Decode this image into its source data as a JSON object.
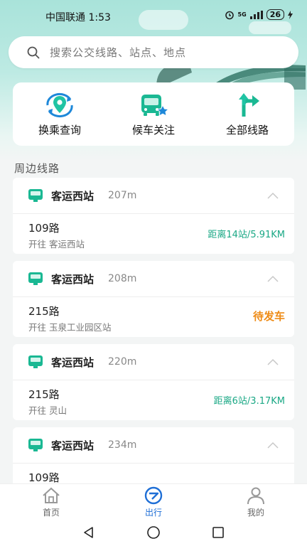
{
  "status_bar": {
    "carrier_time": "中国联通 1:53",
    "signal_label": "5G",
    "battery": "26"
  },
  "search": {
    "placeholder": "搜索公交线路、站点、地点",
    "icon": "search-icon"
  },
  "quick_actions": [
    {
      "label": "换乘查询",
      "icon": "transfer-location-icon"
    },
    {
      "label": "候车关注",
      "icon": "bus-star-icon"
    },
    {
      "label": "全部线路",
      "icon": "route-fork-icon"
    }
  ],
  "section_title": "周边线路",
  "stops": [
    {
      "name": "客运西站",
      "distance": "207m",
      "route": "109路",
      "dest": "开往 客运西站",
      "status": "距离14站/5.91KM",
      "status_type": "distance"
    },
    {
      "name": "客运西站",
      "distance": "208m",
      "route": "215路",
      "dest": "开往 玉泉工业园区站",
      "status": "待发车",
      "status_type": "waiting"
    },
    {
      "name": "客运西站",
      "distance": "220m",
      "route": "215路",
      "dest": "开往 灵山",
      "status": "距离6站/3.17KM",
      "status_type": "distance"
    },
    {
      "name": "客运西站",
      "distance": "234m",
      "route": "109路",
      "dest": "",
      "status": "",
      "status_type": "distance"
    }
  ],
  "tabs": [
    {
      "label": "首页",
      "icon": "home-icon",
      "active": false
    },
    {
      "label": "出行",
      "icon": "travel-icon",
      "active": true
    },
    {
      "label": "我的",
      "icon": "profile-icon",
      "active": false
    }
  ],
  "colors": {
    "accent_teal": "#1aa885",
    "waiting_orange": "#ee8b16",
    "active_blue": "#1f6fd6"
  }
}
